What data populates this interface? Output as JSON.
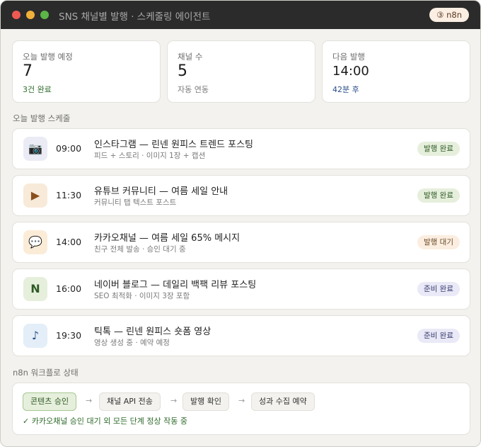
{
  "window": {
    "title": "SNS 채널별 발행 · 스케줄링 에이전트",
    "badge": "③ n8n"
  },
  "stats": [
    {
      "label": "오늘 발행 예정",
      "value": "7",
      "sub": "3건 완료"
    },
    {
      "label": "채널 수",
      "value": "5",
      "sub": "자동 연동"
    },
    {
      "label": "다음 발행",
      "value": "14:00",
      "sub": "42분 후"
    }
  ],
  "schedule": {
    "heading": "오늘 발행 스케줄",
    "items": [
      {
        "icon": "camera-icon",
        "glyph": "📷",
        "time": "09:00",
        "title": "인스타그램 — 린넨 원피스 트렌드 포스팅",
        "desc": "피드 + 스토리 · 이미지 1장 + 캡션",
        "status": "발행 완료",
        "status_type": "done"
      },
      {
        "icon": "play-icon",
        "glyph": "▶",
        "time": "11:30",
        "title": "유튜브 커뮤니티 — 여름 세일 안내",
        "desc": "커뮤니티 탭 텍스트 포스트",
        "status": "발행 완료",
        "status_type": "done"
      },
      {
        "icon": "speech-bubble-icon",
        "glyph": "💬",
        "time": "14:00",
        "title": "카카오채널 — 여름 세일 65% 메시지",
        "desc": "친구 전체 발송 · 승인 대기 중",
        "status": "발행 대기",
        "status_type": "wait"
      },
      {
        "icon": "naver-n-icon",
        "glyph": "N",
        "time": "16:00",
        "title": "네이버 블로그 — 데일리 백팩 리뷰 포스팅",
        "desc": "SEO 최적화 · 이미지 3장 포함",
        "status": "준비 완료",
        "status_type": "ready"
      },
      {
        "icon": "music-note-icon",
        "glyph": "♪",
        "time": "19:30",
        "title": "틱톡 — 린넨 원피스 숏폼 영상",
        "desc": "영상 생성 중 · 예약 예정",
        "status": "준비 완료",
        "status_type": "ready"
      }
    ]
  },
  "workflow": {
    "heading": "n8n 워크플로 상태",
    "steps": [
      "콘텐츠 승인",
      "채널 API 전송",
      "발행 확인",
      "성과 수집 예약"
    ],
    "arrow": "→",
    "status": "✓ 카카오채널 승인 대기 외 모든 단계 정상 작동 중"
  },
  "colors": {
    "titlebar": "#2b2b2b",
    "background": "#f3f2ee",
    "done": "#e6efdc",
    "wait": "#fbeee0",
    "ready": "#e9e9f7"
  }
}
